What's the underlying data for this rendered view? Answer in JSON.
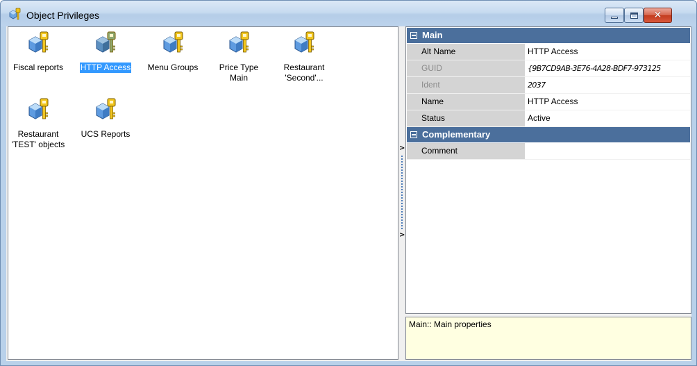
{
  "window": {
    "title": "Object Privileges",
    "controls": {
      "minimize": "minimize",
      "maximize": "maximize",
      "close": "✕"
    }
  },
  "objects": [
    {
      "label": "Fiscal reports",
      "selected": false
    },
    {
      "label": "HTTP Access",
      "selected": true
    },
    {
      "label": "Menu Groups",
      "selected": false
    },
    {
      "label": "Price Type\nMain",
      "selected": false
    },
    {
      "label": "Restaurant\n'Second'...",
      "selected": false
    },
    {
      "label": "Restaurant\n'TEST' objects",
      "selected": false
    },
    {
      "label": "UCS Reports",
      "selected": false
    }
  ],
  "splitter": {
    "arrow": ">"
  },
  "properties": {
    "main_category": "Main",
    "main": [
      {
        "name": "Alt Name",
        "value": "HTTP Access",
        "readonly": false
      },
      {
        "name": "GUID",
        "value": "{9B7CD9AB-3E76-4A28-BDF7-973125",
        "readonly": true
      },
      {
        "name": "Ident",
        "value": "2037",
        "readonly": true
      },
      {
        "name": "Name",
        "value": "HTTP Access",
        "readonly": false
      },
      {
        "name": "Status",
        "value": "Active",
        "readonly": false
      }
    ],
    "complementary_category": "Complementary",
    "complementary": [
      {
        "name": "Comment",
        "value": "",
        "readonly": false
      }
    ]
  },
  "help": {
    "text": "Main:: Main properties"
  },
  "colors": {
    "selection": "#3399ff",
    "category_header": "#4b6f9c",
    "help_background": "#ffffe1",
    "close_button": "#c33b1e"
  }
}
